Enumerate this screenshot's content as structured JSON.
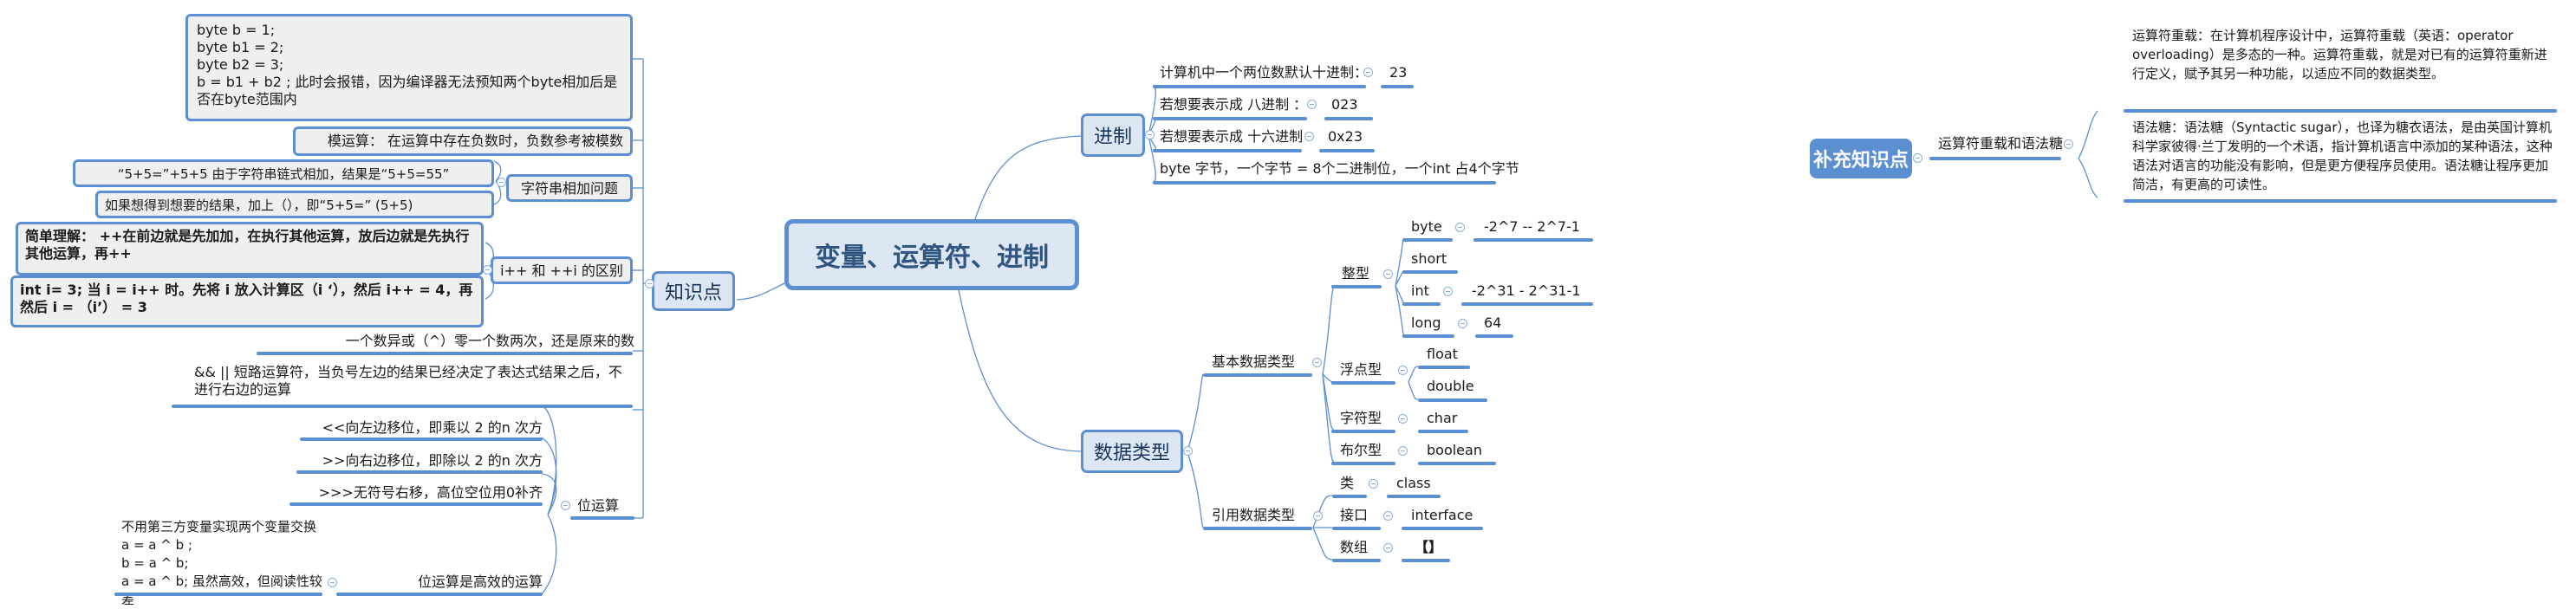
{
  "central_topic": "变量、运算符、进制",
  "branches": {
    "knowledge": {
      "label": "知识点",
      "items": {
        "byte_add": "byte b = 1;\nbyte b1 = 2;\nbyte b2 = 3;\nb = b1 + b2 ; 此时会报错，因为编译器无法预知两个byte相加后是否在byte范围内",
        "modulo": "模运算： 在运算中存在负数时，负数参考被模数",
        "string_concat": {
          "label": "字符串相加问题",
          "children": [
            "“5+5=”+5+5  由于字符串链式相加，结果是“5+5=55”",
            "如果想得到想要的结果，加上（），即“5+5=” (5+5)"
          ]
        },
        "increment": {
          "label": "i++ 和 ++i 的区别",
          "children": [
            "简单理解： ++在前边就是先加加，在执行其他运算，放后边就是先执行其他运算，再++",
            "int i= 3; 当 i = i++ 时。先将 i 放入计算区（i ‘），然后 i++ = 4，再然后 i = （i’） = 3"
          ]
        },
        "xor": "一个数异或（^）零一个数两次，还是原来的数",
        "short_circuit": "&&  || 短路运算符，当负号左边的结果已经决定了表达式结果之后，不进行右边的运算",
        "bitwise": {
          "label": "位运算",
          "children": [
            "<<向左边移位，即乘以 2 的n 次方",
            ">>向右边移位，即除以 2 的n 次方",
            ">>>无符号右移，高位空位用0补齐"
          ],
          "efficient": {
            "label": "位运算是高效的运算",
            "child": "不用第三方变量实现两个变量交换\na = a ^ b ;\nb =       a ^ b;\na = a ^ b; 虽然高效，但阅读性较差"
          }
        }
      }
    },
    "radix": {
      "label": "进制",
      "items": [
        {
          "label": "计算机中一个两位数默认十进制：",
          "value": "23"
        },
        {
          "label": "若想要表示成 八进制 ：",
          "value": "023"
        },
        {
          "label": "若想要表示成 十六进制",
          "value": "0x23"
        },
        {
          "label": "byte 字节，一个字节 = 8个二进制位，一个int 占4个字节",
          "value": null
        }
      ]
    },
    "data_types": {
      "label": "数据类型",
      "primitive": {
        "label": "基本数据类型",
        "integer": {
          "label": "整型",
          "items": [
            {
              "label": "byte",
              "value": "-2^7 -- 2^7-1"
            },
            {
              "label": "short",
              "value": null
            },
            {
              "label": "int",
              "value": "-2^31 - 2^31-1"
            },
            {
              "label": "long",
              "value": "64"
            }
          ]
        },
        "floating": {
          "label": "浮点型",
          "items": [
            "float",
            "double"
          ]
        },
        "char": {
          "label": "字符型",
          "value": "char"
        },
        "boolean": {
          "label": "布尔型",
          "value": "boolean"
        }
      },
      "reference": {
        "label": "引用数据类型",
        "items": [
          {
            "label": "类",
            "value": "class"
          },
          {
            "label": "接口",
            "value": "interface"
          },
          {
            "label": "数组",
            "value": "【】"
          }
        ]
      }
    }
  },
  "supplement": {
    "label": "补充知识点",
    "topic": "运算符重载和语法糖",
    "notes": [
      "运算符重载：在计算机程序设计中，运算符重载（英语：operator overloading）是多态的一种。运算符重载，就是对已有的运算符重新进行定义，赋予其另一种功能，以适应不同的数据类型。",
      "语法糖：语法糖（Syntactic sugar），也译为糖衣语法，是由英国计算机科学家彼得·兰丁发明的一个术语，指计算机语言中添加的某种语法，这种语法对语言的功能没有影响，但是更方便程序员使用。语法糖让程序更加简洁，有更高的可读性。"
    ]
  },
  "colors": {
    "accent": "#5b8fd1",
    "topic_fill": "#dde7f3",
    "box_fill": "#efefef",
    "text": "#1a1a1a"
  }
}
